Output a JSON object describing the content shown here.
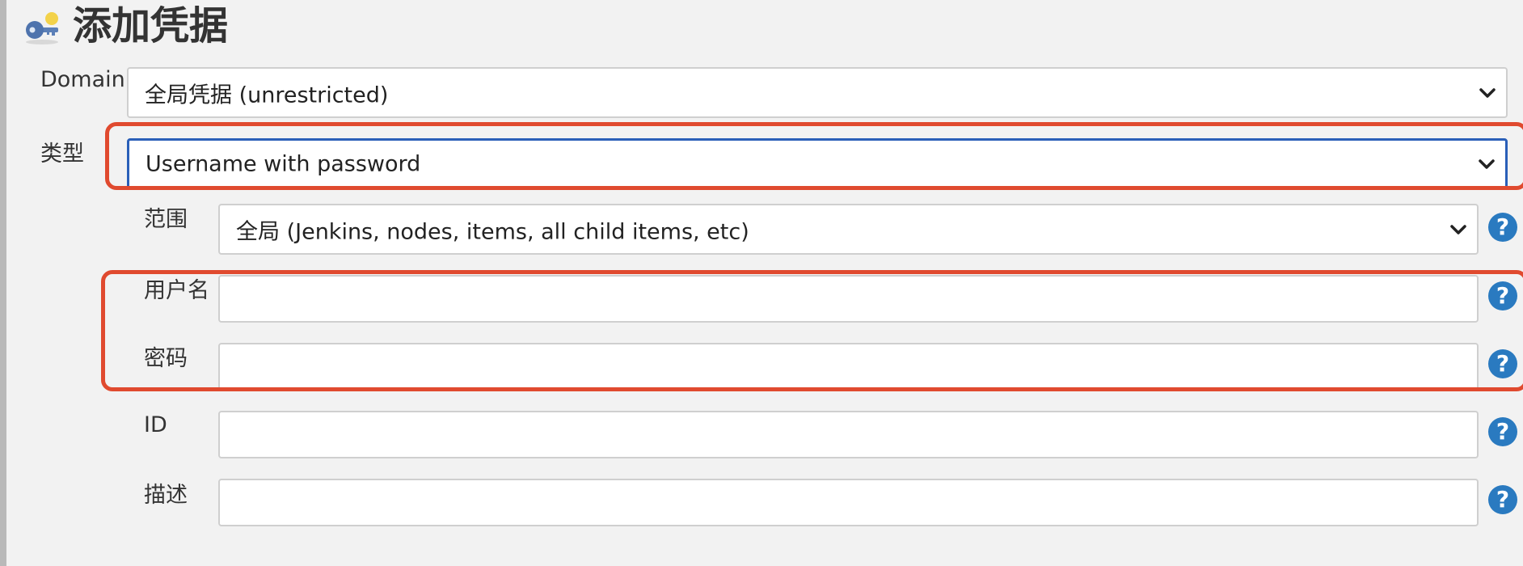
{
  "page": {
    "title": "添加凭据"
  },
  "form": {
    "domain": {
      "label": "Domain",
      "value": "全局凭据 (unrestricted)"
    },
    "kind": {
      "label": "类型",
      "value": "Username with password"
    },
    "scope": {
      "label": "范围",
      "value": "全局 (Jenkins, nodes, items, all child items, etc)"
    },
    "username": {
      "label": "用户名",
      "value": ""
    },
    "password": {
      "label": "密码",
      "value": ""
    },
    "id": {
      "label": "ID",
      "value": ""
    },
    "description": {
      "label": "描述",
      "value": ""
    }
  },
  "help": {
    "glyph": "?"
  },
  "colors": {
    "highlight": "#e04a2f",
    "focus_border": "#2a5fb8",
    "help_icon": "#2a7ac0",
    "background": "#f2f2f2"
  },
  "icons": {
    "title": "key-icon",
    "select": "chevron-down-icon",
    "help": "help-icon"
  }
}
